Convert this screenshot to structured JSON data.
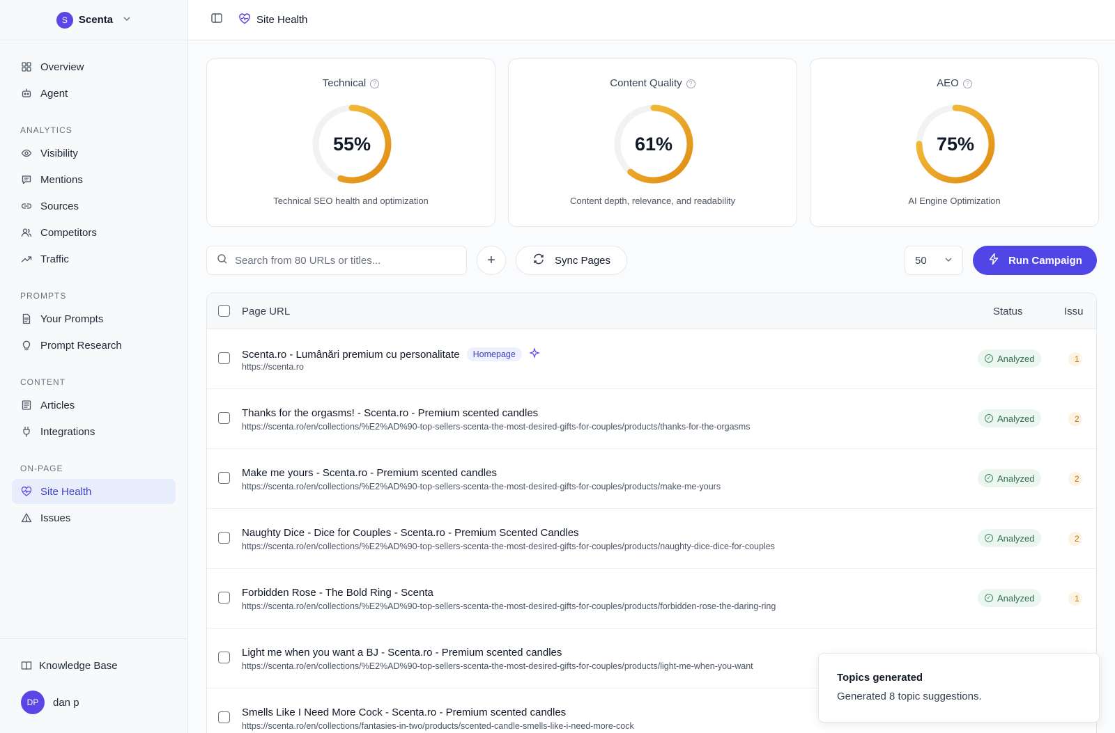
{
  "workspace": {
    "initial": "S",
    "name": "Scenta"
  },
  "topbar": {
    "title": "Site Health"
  },
  "sidebar": {
    "top_items": [
      {
        "label": "Overview",
        "icon": "overview-icon"
      },
      {
        "label": "Agent",
        "icon": "agent-icon"
      }
    ],
    "groups": [
      {
        "label": "ANALYTICS",
        "items": [
          {
            "label": "Visibility",
            "icon": "eye-icon"
          },
          {
            "label": "Mentions",
            "icon": "chat-icon"
          },
          {
            "label": "Sources",
            "icon": "link-icon"
          },
          {
            "label": "Competitors",
            "icon": "users-icon"
          },
          {
            "label": "Traffic",
            "icon": "trend-icon"
          }
        ]
      },
      {
        "label": "PROMPTS",
        "items": [
          {
            "label": "Your Prompts",
            "icon": "document-icon"
          },
          {
            "label": "Prompt Research",
            "icon": "lightbulb-icon"
          }
        ]
      },
      {
        "label": "CONTENT",
        "items": [
          {
            "label": "Articles",
            "icon": "newspaper-icon"
          },
          {
            "label": "Integrations",
            "icon": "plug-icon"
          }
        ]
      },
      {
        "label": "ON-PAGE",
        "items": [
          {
            "label": "Site Health",
            "icon": "heart-pulse-icon",
            "active": true
          },
          {
            "label": "Issues",
            "icon": "warning-icon"
          }
        ]
      }
    ],
    "knowledge_base": "Knowledge Base",
    "user": {
      "initials": "DP",
      "name": "dan p"
    }
  },
  "scores": [
    {
      "title": "Technical",
      "value": 55,
      "label": "55%",
      "description": "Technical SEO health and optimization"
    },
    {
      "title": "Content Quality",
      "value": 61,
      "label": "61%",
      "description": "Content depth, relevance, and readability"
    },
    {
      "title": "AEO",
      "value": 75,
      "label": "75%",
      "description": "AI Engine Optimization"
    }
  ],
  "toolbar": {
    "search_placeholder": "Search from 80 URLs or titles...",
    "add_label": "+",
    "sync_label": "Sync Pages",
    "per_page": "50",
    "run_label": "Run Campaign"
  },
  "table": {
    "columns": [
      "Page URL",
      "Status",
      "Issu"
    ],
    "rows": [
      {
        "title": "Scenta.ro - Lumânări premium cu personalitate",
        "tag": "Homepage",
        "url": "https://scenta.ro",
        "status": "Analyzed",
        "issues": "1"
      },
      {
        "title": "Thanks for the orgasms! - Scenta.ro - Premium scented candles",
        "url": "https://scenta.ro/en/collections/%E2%AD%90-top-sellers-scenta-the-most-desired-gifts-for-couples/products/thanks-for-the-orgasms",
        "status": "Analyzed",
        "issues": "2"
      },
      {
        "title": "Make me yours - Scenta.ro - Premium scented candles",
        "url": "https://scenta.ro/en/collections/%E2%AD%90-top-sellers-scenta-the-most-desired-gifts-for-couples/products/make-me-yours",
        "status": "Analyzed",
        "issues": "2"
      },
      {
        "title": "Naughty Dice - Dice for Couples - Scenta.ro - Premium Scented Candles",
        "url": "https://scenta.ro/en/collections/%E2%AD%90-top-sellers-scenta-the-most-desired-gifts-for-couples/products/naughty-dice-dice-for-couples",
        "status": "Analyzed",
        "issues": "2"
      },
      {
        "title": "Forbidden Rose - The Bold Ring - Scenta",
        "url": "https://scenta.ro/en/collections/%E2%AD%90-top-sellers-scenta-the-most-desired-gifts-for-couples/products/forbidden-rose-the-daring-ring",
        "status": "Analyzed",
        "issues": "1"
      },
      {
        "title": "Light me when you want a BJ - Scenta.ro - Premium scented candles",
        "url": "https://scenta.ro/en/collections/%E2%AD%90-top-sellers-scenta-the-most-desired-gifts-for-couples/products/light-me-when-you-want",
        "status": "",
        "issues": ""
      },
      {
        "title": "Smells Like I Need More Cock - Scenta.ro - Premium scented candles",
        "url": "https://scenta.ro/en/collections/fantasies-in-two/products/scented-candle-smells-like-i-need-more-cock",
        "status": "",
        "issues": ""
      }
    ]
  },
  "toast": {
    "title": "Topics generated",
    "message": "Generated 8 topic suggestions."
  },
  "colors": {
    "accent": "#4f46e5",
    "gauge_start": "#e08a12",
    "gauge_end": "#f6c744",
    "track": "#f1f2f4"
  }
}
